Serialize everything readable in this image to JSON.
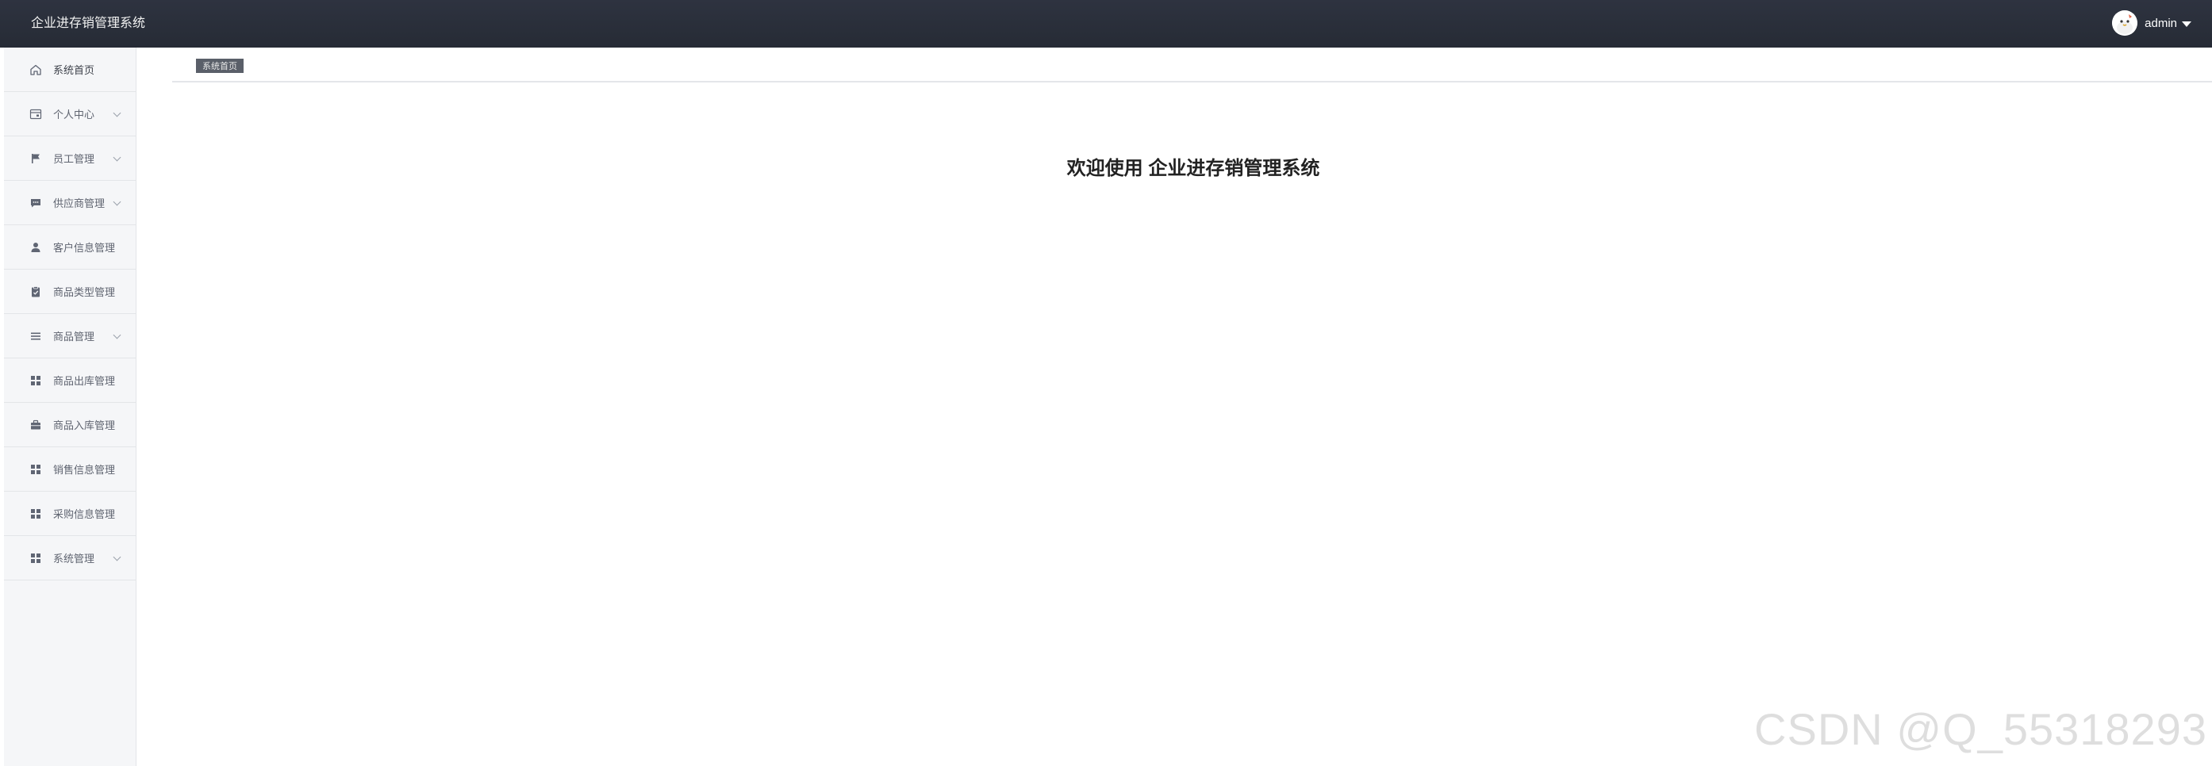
{
  "header": {
    "title": "企业进存销管理系统",
    "username": "admin"
  },
  "sidebar": {
    "items": [
      {
        "label": "系统首页",
        "icon": "home-icon",
        "expandable": false
      },
      {
        "label": "个人中心",
        "icon": "calendar-icon",
        "expandable": true
      },
      {
        "label": "员工管理",
        "icon": "flag-icon",
        "expandable": true
      },
      {
        "label": "供应商管理",
        "icon": "chat-icon",
        "expandable": true
      },
      {
        "label": "客户信息管理",
        "icon": "user-icon",
        "expandable": false
      },
      {
        "label": "商品类型管理",
        "icon": "clipboard-icon",
        "expandable": false
      },
      {
        "label": "商品管理",
        "icon": "list-icon",
        "expandable": true
      },
      {
        "label": "商品出库管理",
        "icon": "grid-icon",
        "expandable": false
      },
      {
        "label": "商品入库管理",
        "icon": "briefcase-icon",
        "expandable": false
      },
      {
        "label": "销售信息管理",
        "icon": "grid-icon",
        "expandable": false
      },
      {
        "label": "采购信息管理",
        "icon": "grid-icon",
        "expandable": false
      },
      {
        "label": "系统管理",
        "icon": "grid-icon",
        "expandable": true
      }
    ]
  },
  "breadcrumb": {
    "current": "系统首页"
  },
  "main": {
    "welcome": "欢迎使用 企业进存销管理系统"
  },
  "watermark": "CSDN @Q_55318293",
  "colors": {
    "header_bg": "#2b303b",
    "sidebar_bg": "#f5f6f8",
    "icon": "#606674",
    "breadcrumb_tag": "#5a5f69"
  }
}
